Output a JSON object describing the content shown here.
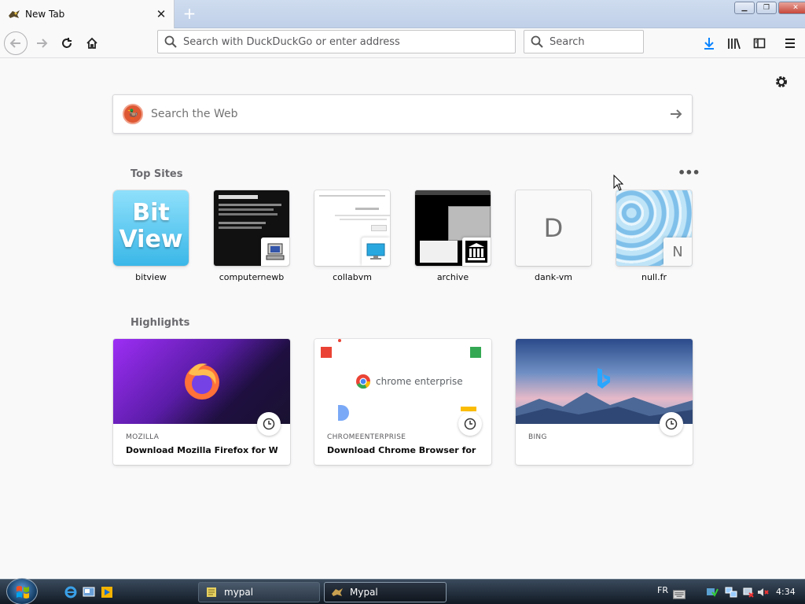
{
  "tab": {
    "title": "New Tab"
  },
  "navbar": {
    "url_placeholder": "Search with DuckDuckGo or enter address",
    "search_placeholder": "Search"
  },
  "content": {
    "web_search_placeholder": "Search the Web",
    "top_sites_title": "Top Sites",
    "highlights_title": "Highlights",
    "top_sites": [
      {
        "label": "bitview"
      },
      {
        "label": "computernewb"
      },
      {
        "label": "collabvm"
      },
      {
        "label": "archive"
      },
      {
        "label": "dank-vm",
        "letter": "D"
      },
      {
        "label": "null.fr",
        "letter": "N"
      }
    ],
    "bitview_logo": {
      "line1": "Bit",
      "line2": "View"
    },
    "highlights": [
      {
        "source": "MOZILLA",
        "title": "Download Mozilla Firefox for Wi..."
      },
      {
        "source": "CHROMEENTERPRISE",
        "title": "Download Chrome Browser for ...",
        "image_text": "chrome enterprise"
      },
      {
        "source": "BING",
        "title": ""
      }
    ]
  },
  "taskbar": {
    "tasks": [
      {
        "label": "mypal"
      },
      {
        "label": "Mypal"
      }
    ],
    "lang": "FR",
    "time": "4:34"
  },
  "colors": {
    "accent": "#0a84ff",
    "ddg": "#de5833",
    "bitview": "#5cc8ef"
  }
}
